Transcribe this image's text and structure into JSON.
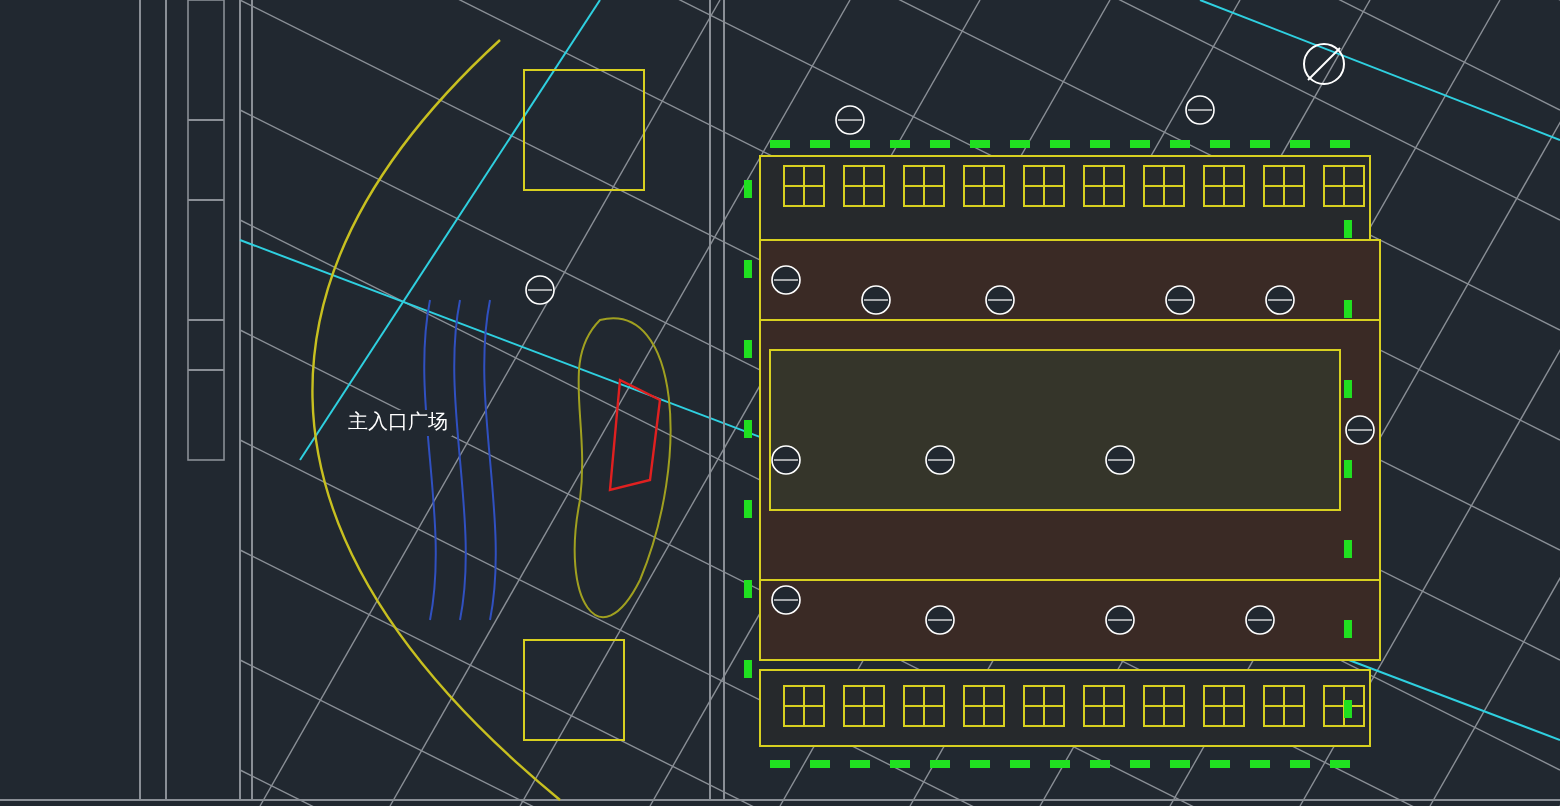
{
  "plan": {
    "labels": [
      {
        "text": "主入口广场"
      }
    ]
  }
}
